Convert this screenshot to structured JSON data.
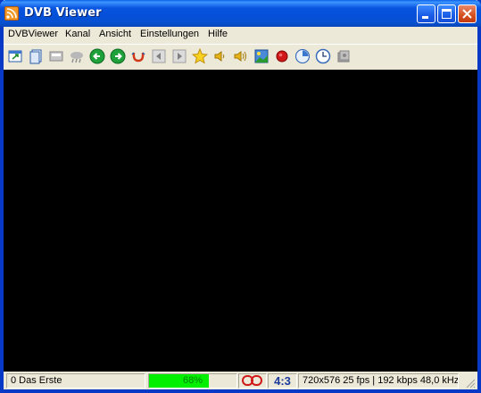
{
  "window": {
    "title": "DVB Viewer"
  },
  "menu": {
    "items": [
      {
        "label": "DVBViewer"
      },
      {
        "label": "Kanal"
      },
      {
        "label": "Ansicht"
      },
      {
        "label": "Einstellungen"
      },
      {
        "label": "Hilfe"
      }
    ]
  },
  "toolbar": {
    "icons": [
      "fullscreen-icon",
      "copy-window-icon",
      "toolbar-toggle-icon",
      "weather-icon",
      "back-arrow-icon",
      "forward-arrow-icon",
      "timeshift-icon",
      "previous-icon",
      "next-icon",
      "favorites-star-icon",
      "volume-down-icon",
      "volume-up-icon",
      "picture-icon",
      "record-icon",
      "epg-icon",
      "timer-clock-icon",
      "recordings-icon"
    ]
  },
  "status": {
    "channel": "0 Das Erste",
    "signal_percent": "68%",
    "signal_level": 0.68,
    "audio_mode": "Dolby",
    "aspect": "4:3",
    "stream_info": "720x576 25 fps | 192 kbps 48,0 kHz",
    "progress_color": "#00F000"
  }
}
